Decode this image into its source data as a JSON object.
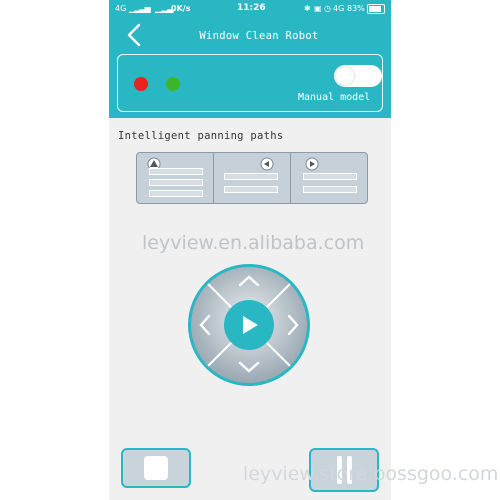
{
  "status_bar": {
    "network_left": "4G",
    "speed": "0K/s",
    "time": "11:26",
    "network_right": "4G",
    "battery": "83%"
  },
  "header": {
    "back_icon": "chevron-left-icon",
    "title": "Window Clean Robot"
  },
  "panel": {
    "indicator_1_color": "#e8231f",
    "indicator_2_color": "#3fb52b",
    "mode_label": "Manual model",
    "toggle_on": false
  },
  "paths_section": {
    "label": "Intelligent panning paths",
    "options": [
      {
        "icon": "up-arrow-icon"
      },
      {
        "icon": "speaker-left-icon"
      },
      {
        "icon": "play-right-icon"
      }
    ]
  },
  "dpad": {
    "up_icon": "chevron-up-icon",
    "down_icon": "chevron-down-icon",
    "left_icon": "chevron-left-icon",
    "right_icon": "chevron-right-icon",
    "center_icon": "play-icon"
  },
  "bottom": {
    "stop_icon": "stop-icon",
    "pause_icon": "pause-icon"
  },
  "watermarks": {
    "center": "leyview.en.alibaba.com",
    "footer": "leyview.store.bossgoo.com"
  },
  "colors": {
    "accent": "#2ab7c4",
    "background": "#f0f0f0",
    "dpad_gray": "#b7c3cc"
  }
}
